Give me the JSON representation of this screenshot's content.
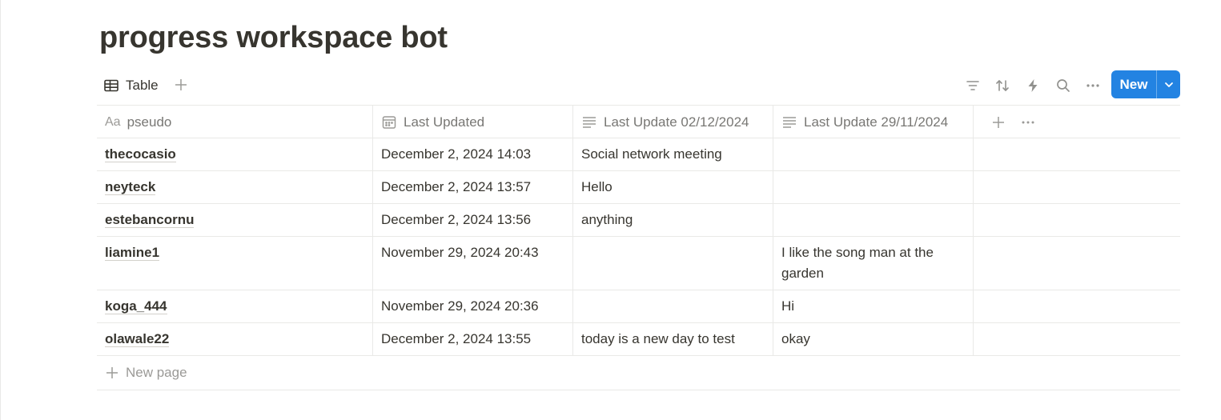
{
  "page": {
    "title": "progress workspace bot"
  },
  "view": {
    "tab_label": "Table"
  },
  "toolbar": {
    "new_label": "New"
  },
  "icons": {
    "table": "table-icon",
    "plus": "plus-icon",
    "filter": "filter-icon",
    "sort": "sort-icon",
    "automation": "lightning-icon",
    "search": "search-icon",
    "more": "more-horizontal-icon",
    "chevron": "chevron-down-icon",
    "date": "calendar-icon",
    "text": "text-lines-icon"
  },
  "colors": {
    "accent": "#2383e2",
    "text": "#37352f",
    "muted": "#787774",
    "border": "#e9e9e7"
  },
  "table": {
    "columns": [
      {
        "label": "pseudo",
        "prefix": "Aa"
      },
      {
        "label": "Last Updated"
      },
      {
        "label": "Last Update 02/12/2024"
      },
      {
        "label": "Last Update 29/11/2024"
      }
    ],
    "rows": [
      {
        "pseudo": "thecocasio",
        "last_updated": "December 2, 2024 14:03",
        "update_0212": "Social network meeting",
        "update_2911": ""
      },
      {
        "pseudo": "neyteck",
        "last_updated": "December 2, 2024 13:57",
        "update_0212": "Hello",
        "update_2911": ""
      },
      {
        "pseudo": "estebancornu",
        "last_updated": "December 2, 2024 13:56",
        "update_0212": "anything",
        "update_2911": ""
      },
      {
        "pseudo": "liamine1",
        "last_updated": "November 29, 2024 20:43",
        "update_0212": "",
        "update_2911": "I like the song man at the garden"
      },
      {
        "pseudo": "koga_444",
        "last_updated": "November 29, 2024 20:36",
        "update_0212": "",
        "update_2911": "Hi"
      },
      {
        "pseudo": "olawale22",
        "last_updated": "December 2, 2024 13:55",
        "update_0212": "today is a new day to test",
        "update_2911": "okay"
      }
    ],
    "new_page_label": "New page"
  }
}
